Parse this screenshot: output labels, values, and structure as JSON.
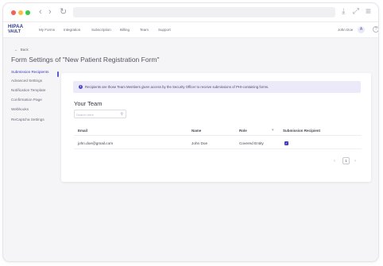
{
  "browser": {
    "back_glyph": "‹",
    "forward_glyph": "›",
    "reload_glyph": "↻",
    "download_glyph": "⤓",
    "expand_glyph": "⤢",
    "menu_glyph": "≡",
    "dot_colors": {
      "red": "#f25f58",
      "yellow": "#f9be3f",
      "green": "#38c84a"
    }
  },
  "header": {
    "logo_line1": "HIPAA",
    "logo_line2": "VAULT",
    "nav": [
      "My Forms",
      "Integration",
      "Subscription",
      "Billing",
      "Team",
      "Support"
    ],
    "user_name": "John Doe",
    "user_icon_glyph": "A",
    "help_glyph": "?"
  },
  "page": {
    "back_label": "Back",
    "back_glyph": "←",
    "title": "Form Settings of \"New Patient Registration Form\""
  },
  "sidebar": {
    "items": [
      {
        "label": "Submission Recipients",
        "active": true
      },
      {
        "label": "Advanced Settings",
        "active": false
      },
      {
        "label": "Notification Template",
        "active": false
      },
      {
        "label": "Confirmation Page",
        "active": false
      },
      {
        "label": "Webhooks",
        "active": false
      },
      {
        "label": "ReCaptcha Settings",
        "active": false
      }
    ]
  },
  "content": {
    "info_icon_glyph": "i",
    "info_text": "Recipients are those Team Members given access by the Security Officer to receive submissions of PHI-containing forms.",
    "section_title": "Your Team",
    "search_placeholder": "Search here",
    "search_icon_glyph": "⚲",
    "table": {
      "headers": [
        "Email",
        "Name",
        "Role",
        "Submission Recipient"
      ],
      "filter_glyph": "▾",
      "rows": [
        {
          "email": "john.doe@gmail.com",
          "name": "John Doe",
          "role": "Covered Entity",
          "recipient_checked": true,
          "check_glyph": "✓"
        }
      ]
    },
    "pagination": {
      "prev_glyph": "‹",
      "current_page": "1",
      "next_glyph": "›"
    }
  },
  "colors": {
    "accent": "#3f3cc0",
    "info_bg": "#eceaf8",
    "title": "#555560"
  }
}
